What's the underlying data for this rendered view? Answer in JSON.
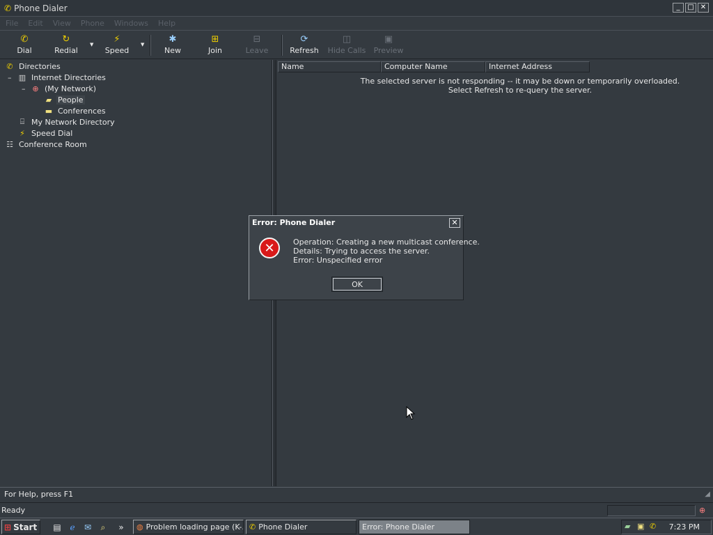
{
  "window": {
    "title": "Phone Dialer"
  },
  "menu": [
    "File",
    "Edit",
    "View",
    "Phone",
    "Windows",
    "Help"
  ],
  "toolbar": {
    "buttons": [
      {
        "label": "Dial",
        "icon": "phone-icon",
        "enabled": true
      },
      {
        "label": "Redial",
        "icon": "redial-icon",
        "enabled": true
      },
      {
        "label": "Speed",
        "icon": "speed-dial-icon",
        "enabled": true
      },
      {
        "label": "New",
        "icon": "new-conference-icon",
        "enabled": true
      },
      {
        "label": "Join",
        "icon": "join-icon",
        "enabled": true
      },
      {
        "label": "Leave",
        "icon": "leave-icon",
        "enabled": false
      },
      {
        "label": "Refresh",
        "icon": "refresh-icon",
        "enabled": true
      },
      {
        "label": "Hide Calls",
        "icon": "hide-calls-icon",
        "enabled": false
      },
      {
        "label": "Preview",
        "icon": "preview-icon",
        "enabled": false
      }
    ]
  },
  "tree": {
    "root": "Directories",
    "internet_directories": "Internet Directories",
    "my_network_node": "(My Network)",
    "people": "People",
    "conferences": "Conferences",
    "my_network_directory": "My Network Directory",
    "speed_dial": "Speed Dial",
    "conference_room": "Conference Room",
    "expander": "–"
  },
  "list": {
    "columns": [
      "Name",
      "Computer Name",
      "Internet Address"
    ],
    "message_line1": "The selected server is not responding -- it may be down or temporarily overloaded.",
    "message_line2": "Select Refresh to re-query the server."
  },
  "status": {
    "help_text": "For Help, press F1",
    "state": "Ready"
  },
  "dialog": {
    "title": "Error: Phone Dialer",
    "close": "✕",
    "operation": "Operation: Creating a new multicast conference.",
    "details": "Details: Trying to access the server.",
    "error": "Error: Unspecified error",
    "ok_label": "OK"
  },
  "taskbar": {
    "start_label": "Start",
    "tasks": [
      {
        "label": "Problem loading page (K-...",
        "active": false
      },
      {
        "label": "Phone Dialer",
        "active": false
      },
      {
        "label": "Error: Phone Dialer",
        "active": true
      }
    ],
    "chevron": "»",
    "clock": "7:23 PM"
  }
}
